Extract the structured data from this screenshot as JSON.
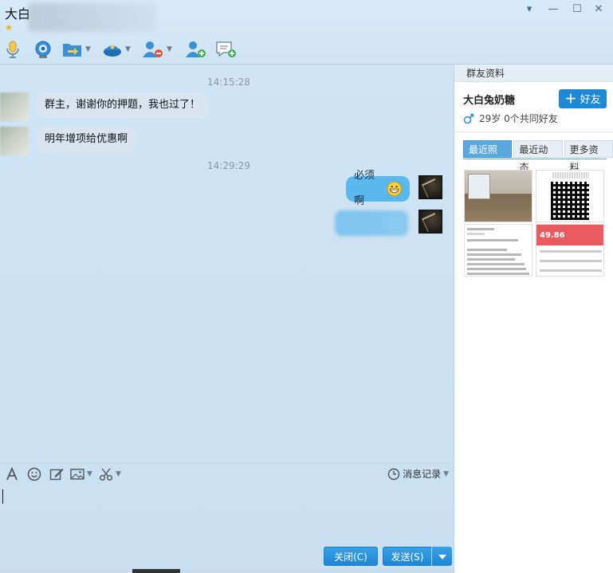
{
  "window": {
    "title": "大白",
    "controls": {
      "dropdown": "▾",
      "minimize": "—",
      "maximize": "☐",
      "close": "✕"
    }
  },
  "toolbar": {
    "icons": [
      "voice-icon",
      "video-icon",
      "file-transfer-icon",
      "police-icon",
      "remove-user-icon",
      "add-user-icon",
      "new-discussion-icon"
    ]
  },
  "chat": {
    "timestamps": [
      "14:15:28",
      "14:29:29"
    ],
    "incoming": [
      {
        "text": "群主，谢谢你的押题，我也过了！"
      },
      {
        "text": "明年增项给优惠啊"
      }
    ],
    "outgoing": [
      {
        "text": "必须啊"
      }
    ]
  },
  "input_toolbar": {
    "history_label": "消息记录"
  },
  "buttons": {
    "close_label": "关闭(C)",
    "send_label": "发送(S)"
  },
  "panel": {
    "header": "群友资料",
    "name": "大白兔奶糖",
    "add_friend_label": "好友",
    "info": "29岁 0个共同好友",
    "tabs": [
      {
        "label": "最近照片",
        "active": true
      },
      {
        "label": "最近动态",
        "active": false
      },
      {
        "label": "更多资料",
        "active": false
      }
    ],
    "photo4_amount": "49.86"
  },
  "colors": {
    "accent": "#1e8ad7",
    "outgoing_bubble": "#5bb8ef",
    "incoming_bubble": "#d9e4ee"
  }
}
